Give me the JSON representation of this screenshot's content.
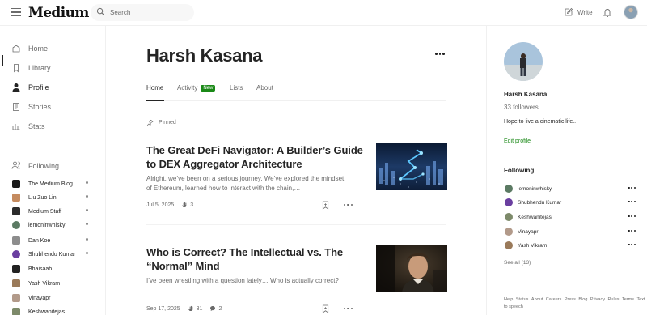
{
  "topbar": {
    "logo": "Medium",
    "search_placeholder": "Search",
    "write_label": "Write"
  },
  "sidebar": {
    "nav": [
      {
        "label": "Home",
        "icon": "home-icon"
      },
      {
        "label": "Library",
        "icon": "library-icon"
      },
      {
        "label": "Profile",
        "icon": "profile-icon"
      },
      {
        "label": "Stories",
        "icon": "stories-icon"
      },
      {
        "label": "Stats",
        "icon": "stats-icon"
      }
    ],
    "following_label": "Following",
    "following": [
      {
        "name": "The Medium Blog",
        "color": "#1a1a1a",
        "dot": true
      },
      {
        "name": "Liu Zuo Lin",
        "color": "#c58b5f",
        "dot": true
      },
      {
        "name": "Medium Staff",
        "color": "#2b2b2b",
        "dot": true
      },
      {
        "name": "lemoninwhisky",
        "color": "#5b7a63",
        "dot": true
      },
      {
        "name": "Dan Koe",
        "color": "#8d8d8d",
        "dot": true
      },
      {
        "name": "Shubhendu Kumar",
        "color": "#6a3fa0",
        "dot": true
      },
      {
        "name": "Bhaisaab",
        "color": "#222222",
        "dot": false
      },
      {
        "name": "Yash Vikram",
        "color": "#9a7a5a",
        "dot": false
      },
      {
        "name": "Vinayapr",
        "color": "#b29a8a",
        "dot": false
      },
      {
        "name": "Keshwanitejas",
        "color": "#7d8a6a",
        "dot": false
      }
    ]
  },
  "profile": {
    "name": "Harsh Kasana",
    "tabs": [
      {
        "label": "Home"
      },
      {
        "label": "Activity",
        "badge": "New"
      },
      {
        "label": "Lists"
      },
      {
        "label": "About"
      }
    ],
    "pinned_label": "Pinned"
  },
  "articles": [
    {
      "title": "The Great DeFi Navigator: A Builder’s Guide to DEX Aggregator Architecture",
      "excerpt": "Alright, we’ve been on a serious journey. We’ve explored the mindset of Ethereum, learned how to interact with the chain,…",
      "date": "Jul 5, 2025",
      "claps": "3",
      "responses": null
    },
    {
      "title": "Who is Correct? The Intellectual vs. The “Normal” Mind",
      "excerpt": "I’ve been wrestling with a question lately… Who is actually correct?",
      "date": "Sep 17, 2025",
      "claps": "31",
      "responses": "2"
    }
  ],
  "rightbar": {
    "name": "Harsh Kasana",
    "followers": "33 followers",
    "bio": "Hope to live a cinematic life..",
    "edit_label": "Edit profile",
    "following_title": "Following",
    "following": [
      {
        "name": "lemoninwhisky",
        "color": "#5b7a63"
      },
      {
        "name": "Shubhendu Kumar",
        "color": "#6a3fa0"
      },
      {
        "name": "Keshwanitejas",
        "color": "#7d8a6a"
      },
      {
        "name": "Vinayapr",
        "color": "#b29a8a"
      },
      {
        "name": "Yash Vikram",
        "color": "#9a7a5a"
      }
    ],
    "see_all": "See all (13)",
    "footer": [
      "Help",
      "Status",
      "About",
      "Careers",
      "Press",
      "Blog",
      "Privacy",
      "Rules",
      "Terms",
      "Text to speech"
    ]
  },
  "colors": {
    "accent_green": "#1a8917",
    "text": "#242424",
    "muted": "#6b6b6b"
  }
}
